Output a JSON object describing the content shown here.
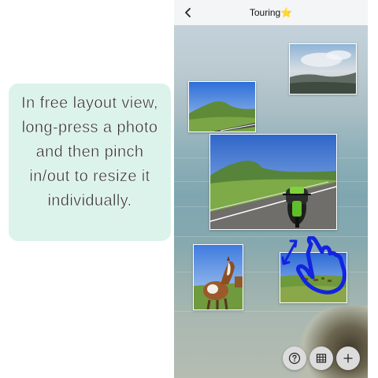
{
  "hint": {
    "text": "In free layout view, long-press a photo and then pinch in/out to resize it individually."
  },
  "header": {
    "title": "Touring",
    "title_emoji": "⭐"
  },
  "photos": [
    {
      "subject": "cloudy-landscape"
    },
    {
      "subject": "green-hill"
    },
    {
      "subject": "motorcycle-on-road"
    },
    {
      "subject": "horse"
    },
    {
      "subject": "grazing-field"
    }
  ],
  "toolbar": {
    "help_icon": "help-icon",
    "layout_icon": "grid-icon",
    "add_icon": "plus-icon"
  },
  "colors": {
    "hint_background": "#dcf3ec",
    "gesture_blue": "#1224e0"
  }
}
